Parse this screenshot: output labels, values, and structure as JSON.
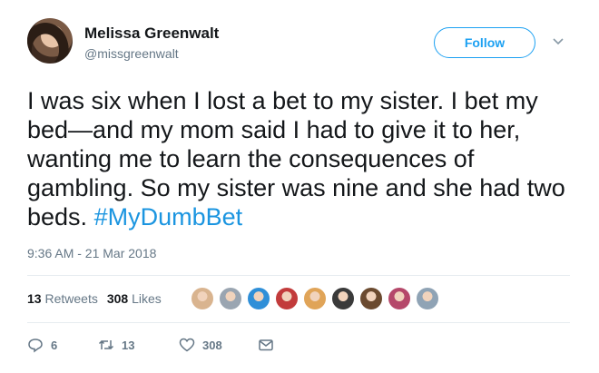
{
  "tweet": {
    "author_name": "Melissa Greenwalt",
    "author_handle": "@missgreenwalt",
    "follow_label": "Follow",
    "text_main": "I was six when I lost a bet to my sister. I bet my bed—and my mom said I had to give it to her, wanting me to learn the consequences of gambling. So my sister was nine and she had two beds. ",
    "hashtag": "#MyDumbBet",
    "timestamp": "9:36 AM - 21 Mar 2018"
  },
  "stats": {
    "retweets_count": "13",
    "retweets_label": "Retweets",
    "likes_count": "308",
    "likes_label": "Likes",
    "liker_avatars": [
      {
        "color": "#d9b48f"
      },
      {
        "color": "#9aa5b1"
      },
      {
        "color": "#2f8fd8"
      },
      {
        "color": "#c23b3b"
      },
      {
        "color": "#e0a458"
      },
      {
        "color": "#3a3a3a"
      },
      {
        "color": "#6b4a2f"
      },
      {
        "color": "#b5486a"
      },
      {
        "color": "#8fa3b5"
      }
    ]
  },
  "actions": {
    "reply_count": "6",
    "retweet_count": "13",
    "like_count": "308"
  },
  "colors": {
    "accent": "#1da1f2",
    "hashtag": "#1b95e0",
    "muted": "#657786",
    "text": "#14171a"
  },
  "icons": {
    "reply": "reply-icon",
    "retweet": "retweet-icon",
    "like": "heart-icon",
    "dm": "envelope-icon",
    "caret": "chevron-down-icon"
  }
}
